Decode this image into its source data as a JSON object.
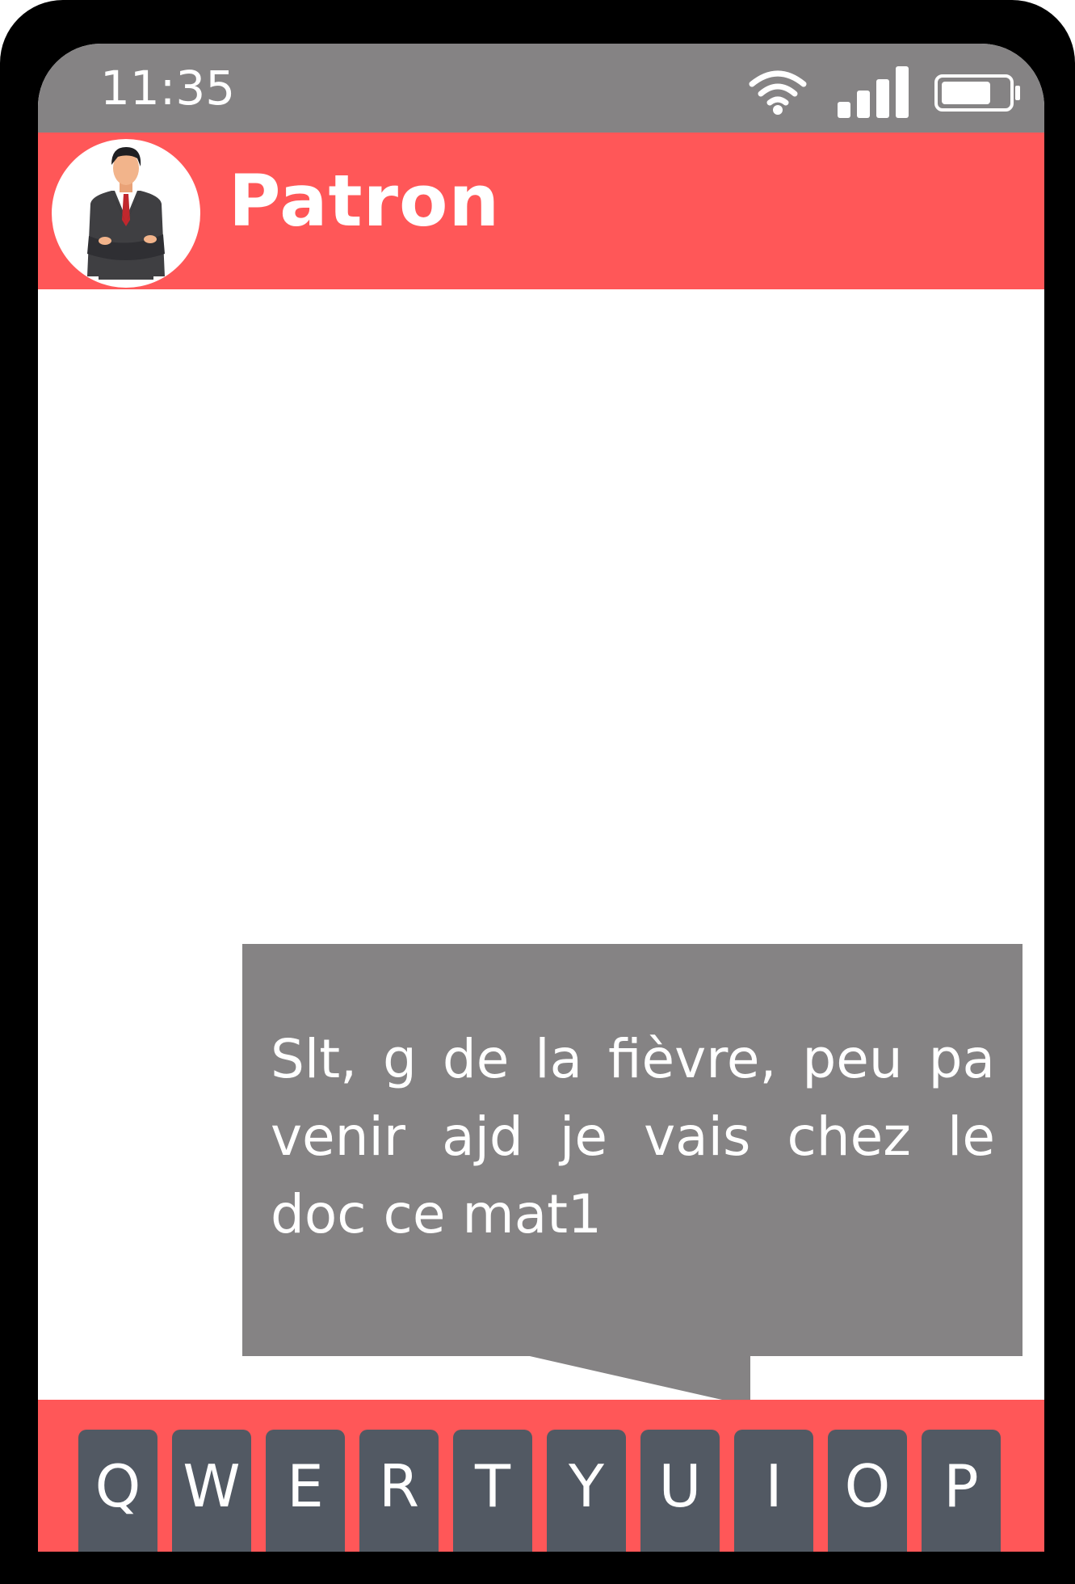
{
  "status_bar": {
    "time": "11:35",
    "icons": [
      "wifi-icon",
      "signal-icon",
      "battery-icon"
    ]
  },
  "chat_header": {
    "contact_name": "Patron",
    "avatar_icon": "businessman-avatar-icon"
  },
  "message": {
    "text": "Slt, g de la fièvre, peu pa venir ajd je vais chez le doc ce mat1"
  },
  "keyboard": {
    "keys": [
      "Q",
      "W",
      "E",
      "R",
      "T",
      "Y",
      "U",
      "I",
      "O",
      "P"
    ]
  },
  "colors": {
    "accent": "#ff5758",
    "status_bar": "#858384",
    "bubble": "#858384",
    "key": "#525963",
    "frame": "#000000"
  }
}
